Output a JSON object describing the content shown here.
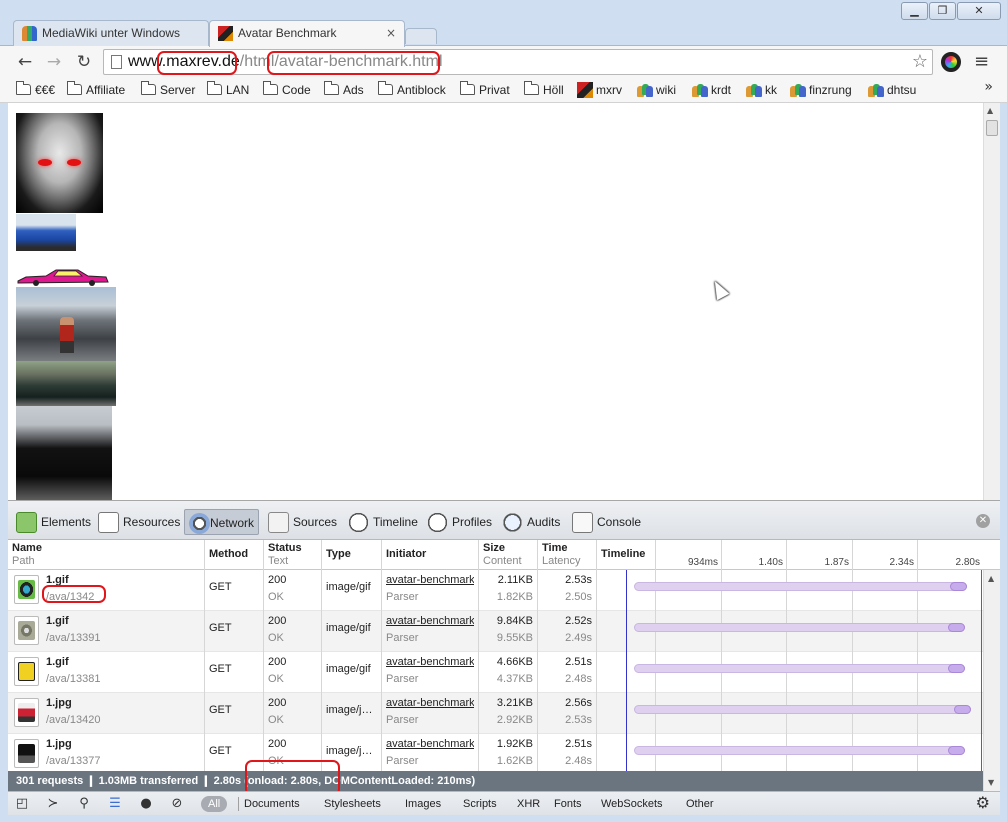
{
  "browser": {
    "tabs": [
      {
        "title": "MediaWiki unter Windows",
        "active": false
      },
      {
        "title": "Avatar Benchmark",
        "active": true,
        "close": "×"
      }
    ],
    "url": {
      "prefix": "www.",
      "host": "maxrev.de",
      "sep": "/",
      "path1": "html",
      "sep2": "/",
      "path2": "avatar-benchmark.html"
    },
    "bookmarks": [
      "€€€",
      "Affiliate",
      "Server",
      "LAN",
      "Code",
      "Ads",
      "Antiblock",
      "Privat",
      "Höll",
      "mxrv",
      "wiki",
      "krdt",
      "kk",
      "finzrung",
      "dhtsu"
    ],
    "more": "»"
  },
  "devtools": {
    "tabs": [
      "Elements",
      "Resources",
      "Network",
      "Sources",
      "Timeline",
      "Profiles",
      "Audits",
      "Console"
    ],
    "selected_tab": "Network",
    "columns": [
      {
        "main": "Name",
        "sub": "Path"
      },
      {
        "main": "Method",
        "sub": ""
      },
      {
        "main": "Status",
        "sub": "Text"
      },
      {
        "main": "Type",
        "sub": ""
      },
      {
        "main": "Initiator",
        "sub": ""
      },
      {
        "main": "Size",
        "sub": "Content"
      },
      {
        "main": "Time",
        "sub": "Latency"
      },
      {
        "main": "Timeline",
        "sub": ""
      }
    ],
    "timeline_ticks": [
      "934ms",
      "1.40s",
      "1.87s",
      "2.34s",
      "2.80s"
    ],
    "rows": [
      {
        "name": "1.gif",
        "path": "/ava/1342",
        "method": "GET",
        "status": "200",
        "status_text": "OK",
        "type": "image/gif",
        "initiator": "avatar-benchmark",
        "initiator_sub": "Parser",
        "size": "2.11KB",
        "content": "1.82KB",
        "time": "2.53s",
        "latency": "2.50s"
      },
      {
        "name": "1.gif",
        "path": "/ava/13391",
        "method": "GET",
        "status": "200",
        "status_text": "OK",
        "type": "image/gif",
        "initiator": "avatar-benchmark",
        "initiator_sub": "Parser",
        "size": "9.84KB",
        "content": "9.55KB",
        "time": "2.52s",
        "latency": "2.49s"
      },
      {
        "name": "1.gif",
        "path": "/ava/13381",
        "method": "GET",
        "status": "200",
        "status_text": "OK",
        "type": "image/gif",
        "initiator": "avatar-benchmark",
        "initiator_sub": "Parser",
        "size": "4.66KB",
        "content": "4.37KB",
        "time": "2.51s",
        "latency": "2.48s"
      },
      {
        "name": "1.jpg",
        "path": "/ava/13420",
        "method": "GET",
        "status": "200",
        "status_text": "OK",
        "type": "image/j…",
        "initiator": "avatar-benchmark",
        "initiator_sub": "Parser",
        "size": "3.21KB",
        "content": "2.92KB",
        "time": "2.56s",
        "latency": "2.53s"
      },
      {
        "name": "1.jpg",
        "path": "/ava/13377",
        "method": "GET",
        "status": "200",
        "status_text": "OK",
        "type": "image/j…",
        "initiator": "avatar-benchmark",
        "initiator_sub": "Parser",
        "size": "1.92KB",
        "content": "1.62KB",
        "time": "2.51s",
        "latency": "2.48s"
      }
    ],
    "summary": "301 requests  ❙  1.03MB transferred  ❙  2.80s (onload: 2.80s, DOMContentLoaded: 210ms)",
    "filters": [
      "All",
      "Documents",
      "Stylesheets",
      "Images",
      "Scripts",
      "XHR",
      "Fonts",
      "WebSockets",
      "Other"
    ]
  },
  "colors": {
    "annotation": "#e0161b",
    "timeline_bar": "#ded0ee",
    "summary_bg": "#6a7580"
  }
}
